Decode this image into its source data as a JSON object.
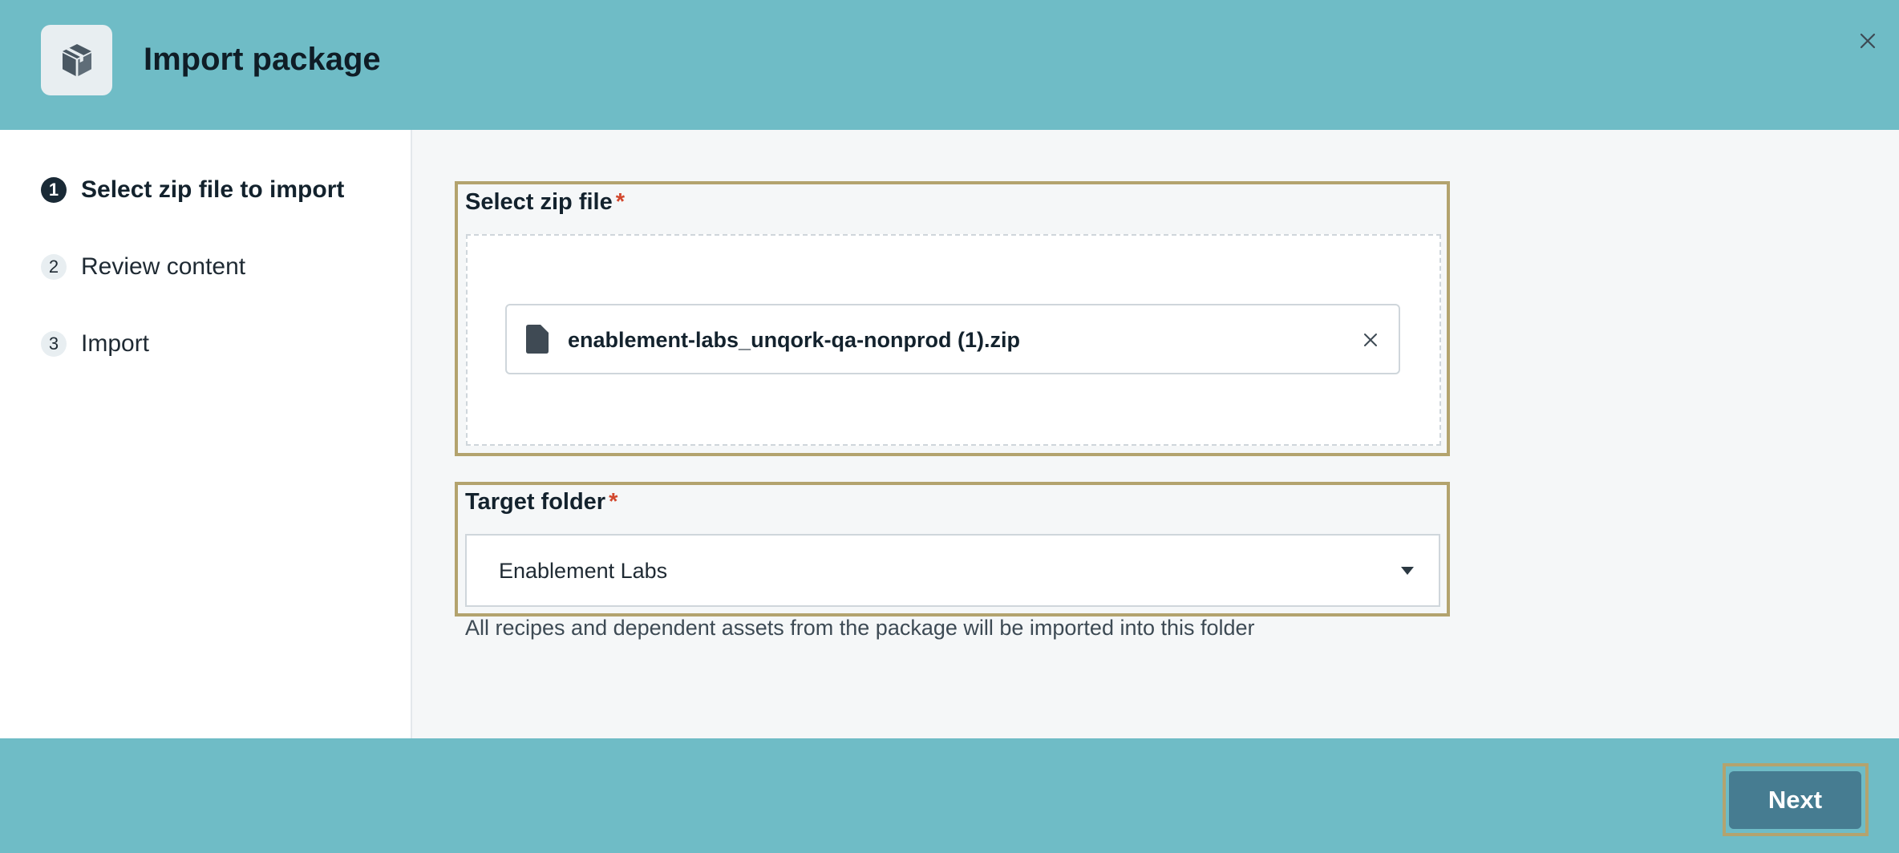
{
  "dialog": {
    "title": "Import package"
  },
  "steps": [
    {
      "number": "1",
      "label": "Select zip file to import",
      "active": true
    },
    {
      "number": "2",
      "label": "Review content",
      "active": false
    },
    {
      "number": "3",
      "label": "Import",
      "active": false
    }
  ],
  "zip_field": {
    "label": "Select zip file",
    "required_marker": "*",
    "file_name": "enablement-labs_unqork-qa-nonprod (1).zip"
  },
  "folder_field": {
    "label": "Target folder",
    "required_marker": "*",
    "selected_value": "Enablement Labs",
    "helper_text": "All recipes and dependent assets from the package will be imported into this folder"
  },
  "footer": {
    "next_label": "Next"
  },
  "colors": {
    "header_bg": "#6fbcc6",
    "highlight_border": "#b3a36e",
    "primary_button": "#467c91",
    "required": "#d2472d"
  },
  "icons": {
    "header": "package-icon",
    "close": "close-icon",
    "file": "file-icon",
    "remove": "remove-file-icon",
    "dropdown": "caret-down-icon"
  }
}
